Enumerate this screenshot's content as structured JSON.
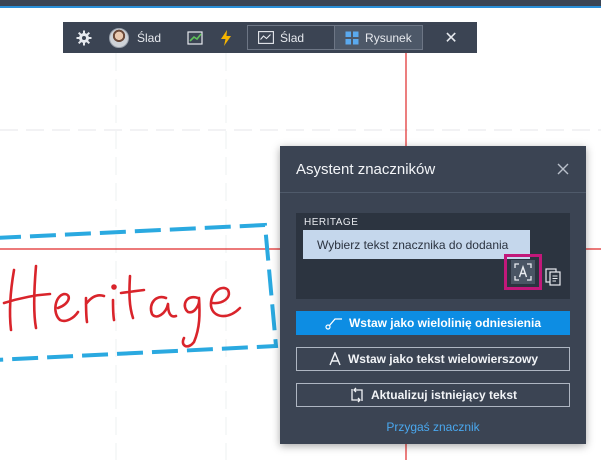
{
  "toolbar": {
    "user_name": "Ślad",
    "toggle_markup_label": "Ślad",
    "toggle_drawing_label": "Rysunek",
    "close_glyph": "✕"
  },
  "panel": {
    "title": "Asystent znaczników",
    "selected_text": "HERITAGE",
    "tooltip": "Wybierz tekst znacznika do dodania",
    "buttons": [
      {
        "label": "Wstaw jako wielolinię odniesienia"
      },
      {
        "label": "Wstaw jako tekst wielowierszowy"
      },
      {
        "label": "Aktualizuj istniejący tekst"
      }
    ],
    "link": "Przygaś znacznik"
  },
  "markup": {
    "handwritten_text": "Heritage"
  },
  "colors": {
    "accent": "#0d8de3",
    "highlight": "#c2187a",
    "markup_red": "#d9242b",
    "markup_cyan": "#2aa9e0",
    "panel_bg": "#3b4453"
  }
}
